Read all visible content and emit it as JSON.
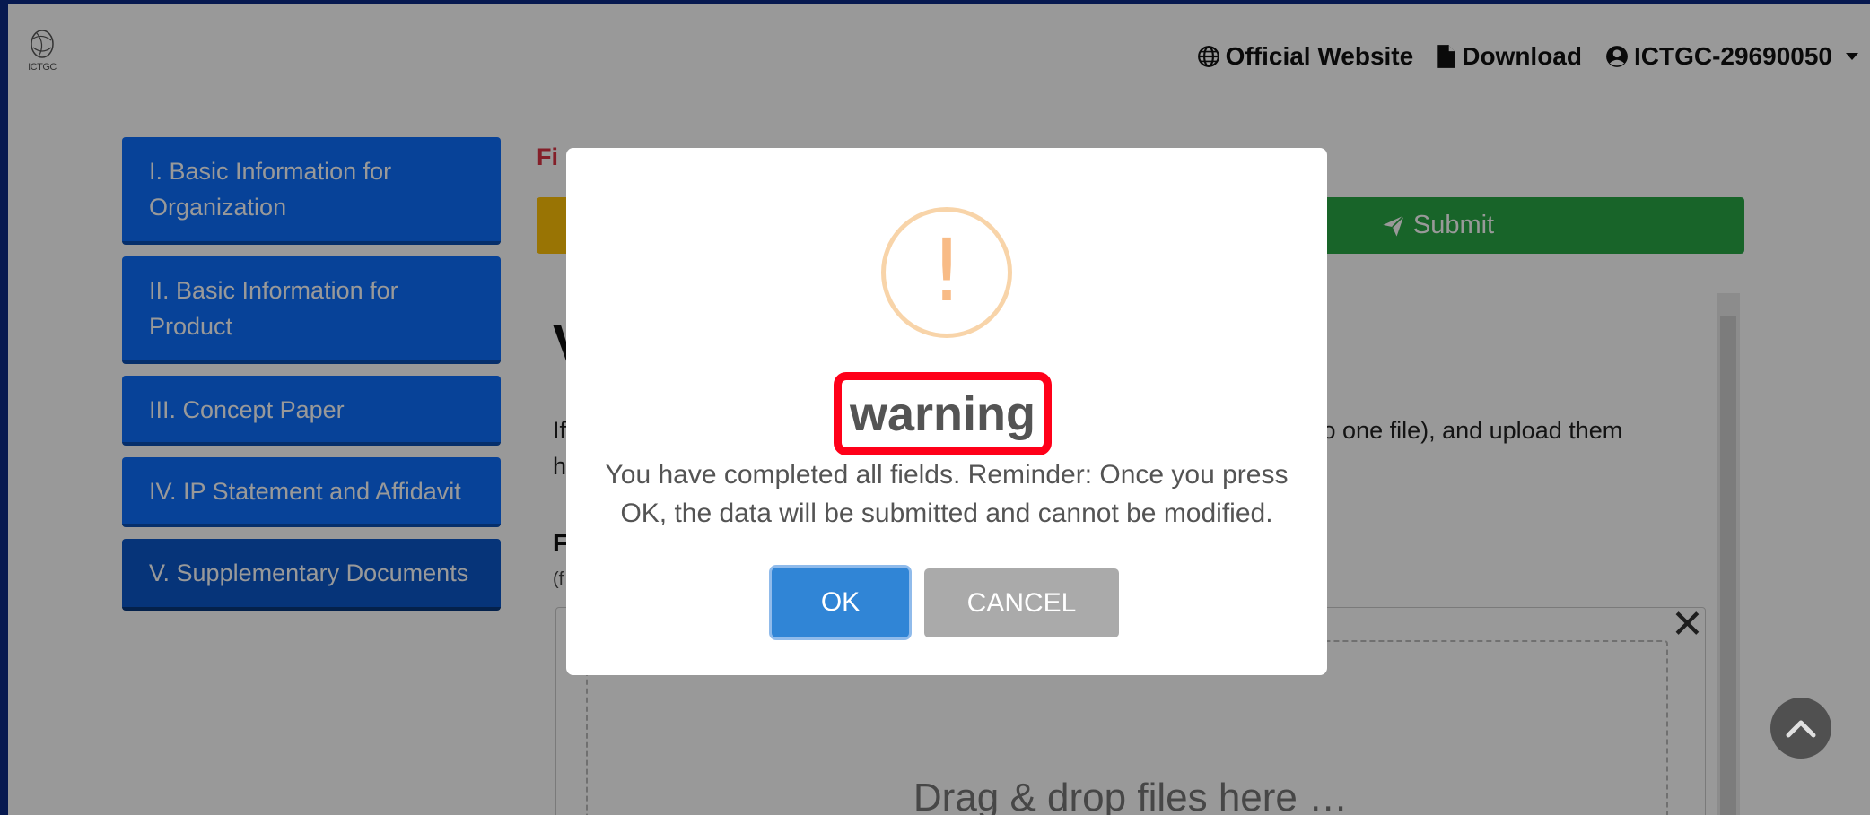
{
  "header": {
    "logo_text": "ICTGC",
    "nav": {
      "official_website": "Official Website",
      "download": "Download",
      "user": "ICTGC-29690050"
    }
  },
  "sidebar": {
    "items": [
      {
        "label": "I. Basic Information for Organization"
      },
      {
        "label": "II. Basic Information for Product"
      },
      {
        "label": "III. Concept Paper"
      },
      {
        "label": "IV. IP Statement and Affidavit"
      },
      {
        "label": "V. Supplementary Documents",
        "active": true
      }
    ]
  },
  "main": {
    "required_note": "Fi",
    "submit_label": "Submit",
    "heading": "V",
    "text_left": "If",
    "text_left2": "h",
    "text_right": "nto one file), and upload them",
    "field_label": "F",
    "field_sub": "(f",
    "drop_text": "Drag & drop files here …"
  },
  "modal": {
    "title": "warning",
    "message": "You have completed all fields. Reminder: Once you press OK, the data will be submitted and cannot be modified.",
    "ok_label": "OK",
    "cancel_label": "CANCEL"
  },
  "icons": {
    "globe": "globe-icon",
    "file": "file-icon",
    "user": "user-circle-icon",
    "caret": "caret-down-icon",
    "send": "paper-plane-icon",
    "close": "close-icon",
    "scroll_top": "chevron-up-icon",
    "warning": "warning-icon"
  },
  "colors": {
    "primary": "#0d6efd",
    "success": "#28a745",
    "warning_button": "#ffc107",
    "ok_button": "#3085d6",
    "cancel_button": "#aaaaaa",
    "highlight_box": "#ff0019",
    "required_text": "#dc3545"
  }
}
